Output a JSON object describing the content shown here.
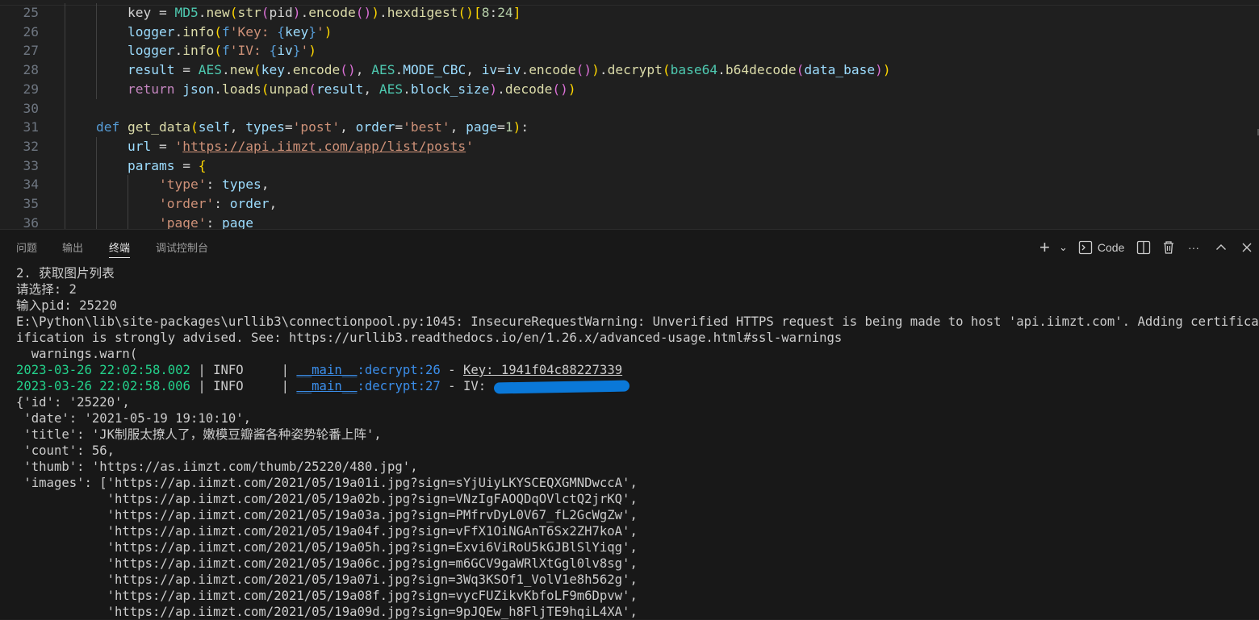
{
  "editor": {
    "lines": [
      {
        "num": "25",
        "tokens": [
          [
            "pl",
            "key = "
          ],
          [
            "cls",
            "MD5"
          ],
          [
            "pl",
            "."
          ],
          [
            "fn",
            "new"
          ],
          [
            "p1",
            "("
          ],
          [
            "fn",
            "str"
          ],
          [
            "p2",
            "("
          ],
          [
            "pl",
            "pid"
          ],
          [
            "p2",
            ")"
          ],
          [
            "pl",
            "."
          ],
          [
            "fn",
            "encode"
          ],
          [
            "p2",
            "()"
          ],
          [
            "p1",
            ")"
          ],
          [
            "pl",
            "."
          ],
          [
            "fn",
            "hexdigest"
          ],
          [
            "p1",
            "()"
          ],
          [
            "p1",
            "["
          ],
          [
            "num",
            "8"
          ],
          [
            "pl",
            ":"
          ],
          [
            "num",
            "24"
          ],
          [
            "p1",
            "]"
          ]
        ],
        "indent": 2
      },
      {
        "num": "26",
        "tokens": [
          [
            "var",
            "logger"
          ],
          [
            "pl",
            "."
          ],
          [
            "fn",
            "info"
          ],
          [
            "p1",
            "("
          ],
          [
            "kw",
            "f"
          ],
          [
            "str",
            "'Key: "
          ],
          [
            "kw",
            "{"
          ],
          [
            "var",
            "key"
          ],
          [
            "kw",
            "}"
          ],
          [
            "str",
            "'"
          ],
          [
            "p1",
            ")"
          ]
        ],
        "indent": 2
      },
      {
        "num": "27",
        "tokens": [
          [
            "var",
            "logger"
          ],
          [
            "pl",
            "."
          ],
          [
            "fn",
            "info"
          ],
          [
            "p1",
            "("
          ],
          [
            "kw",
            "f"
          ],
          [
            "str",
            "'IV: "
          ],
          [
            "kw",
            "{"
          ],
          [
            "var",
            "iv"
          ],
          [
            "kw",
            "}"
          ],
          [
            "str",
            "'"
          ],
          [
            "p1",
            ")"
          ]
        ],
        "indent": 2
      },
      {
        "num": "28",
        "tokens": [
          [
            "var",
            "result"
          ],
          [
            "pl",
            " = "
          ],
          [
            "cls",
            "AES"
          ],
          [
            "pl",
            "."
          ],
          [
            "fn",
            "new"
          ],
          [
            "p1",
            "("
          ],
          [
            "var",
            "key"
          ],
          [
            "pl",
            "."
          ],
          [
            "fn",
            "encode"
          ],
          [
            "p2",
            "()"
          ],
          [
            "pl",
            ", "
          ],
          [
            "cls",
            "AES"
          ],
          [
            "pl",
            "."
          ],
          [
            "var",
            "MODE_CBC"
          ],
          [
            "pl",
            ", "
          ],
          [
            "var",
            "iv"
          ],
          [
            "pl",
            "="
          ],
          [
            "var",
            "iv"
          ],
          [
            "pl",
            "."
          ],
          [
            "fn",
            "encode"
          ],
          [
            "p2",
            "()"
          ],
          [
            "p1",
            ")"
          ],
          [
            "pl",
            "."
          ],
          [
            "fn",
            "decrypt"
          ],
          [
            "p1",
            "("
          ],
          [
            "cls",
            "base64"
          ],
          [
            "pl",
            "."
          ],
          [
            "fn",
            "b64decode"
          ],
          [
            "p2",
            "("
          ],
          [
            "var",
            "data_base"
          ],
          [
            "p2",
            ")"
          ],
          [
            "p1",
            ")"
          ]
        ],
        "indent": 2
      },
      {
        "num": "29",
        "tokens": [
          [
            "ctrl",
            "return "
          ],
          [
            "var",
            "json"
          ],
          [
            "pl",
            "."
          ],
          [
            "fn",
            "loads"
          ],
          [
            "p1",
            "("
          ],
          [
            "fn",
            "unpad"
          ],
          [
            "p2",
            "("
          ],
          [
            "var",
            "result"
          ],
          [
            "pl",
            ", "
          ],
          [
            "cls",
            "AES"
          ],
          [
            "pl",
            "."
          ],
          [
            "var",
            "block_size"
          ],
          [
            "p2",
            ")"
          ],
          [
            "pl",
            "."
          ],
          [
            "fn",
            "decode"
          ],
          [
            "p2",
            "()"
          ],
          [
            "p1",
            ")"
          ]
        ],
        "indent": 2
      },
      {
        "num": "30",
        "tokens": [],
        "indent": 1
      },
      {
        "num": "31",
        "tokens": [
          [
            "kw",
            "def "
          ],
          [
            "fn",
            "get_data"
          ],
          [
            "p1",
            "("
          ],
          [
            "var",
            "self"
          ],
          [
            "pl",
            ", "
          ],
          [
            "var",
            "types"
          ],
          [
            "pl",
            "="
          ],
          [
            "str",
            "'post'"
          ],
          [
            "pl",
            ", "
          ],
          [
            "var",
            "order"
          ],
          [
            "pl",
            "="
          ],
          [
            "str",
            "'best'"
          ],
          [
            "pl",
            ", "
          ],
          [
            "var",
            "page"
          ],
          [
            "pl",
            "="
          ],
          [
            "num",
            "1"
          ],
          [
            "p1",
            ")"
          ],
          [
            "pl",
            ":"
          ]
        ],
        "indent": 1
      },
      {
        "num": "32",
        "tokens": [
          [
            "var",
            "url"
          ],
          [
            "pl",
            " = "
          ],
          [
            "str",
            "'"
          ],
          [
            "url",
            "https://api.iimzt.com/app/list/posts"
          ],
          [
            "str",
            "'"
          ]
        ],
        "indent": 2
      },
      {
        "num": "33",
        "tokens": [
          [
            "var",
            "params"
          ],
          [
            "pl",
            " = "
          ],
          [
            "p1",
            "{"
          ]
        ],
        "indent": 2
      },
      {
        "num": "34",
        "tokens": [
          [
            "str",
            "'type'"
          ],
          [
            "pl",
            ": "
          ],
          [
            "var",
            "types"
          ],
          [
            "pl",
            ","
          ]
        ],
        "indent": 3
      },
      {
        "num": "35",
        "tokens": [
          [
            "str",
            "'order'"
          ],
          [
            "pl",
            ": "
          ],
          [
            "var",
            "order"
          ],
          [
            "pl",
            ","
          ]
        ],
        "indent": 3
      },
      {
        "num": "36",
        "tokens": [
          [
            "str",
            "'page'"
          ],
          [
            "pl",
            ": "
          ],
          [
            "var",
            "page"
          ]
        ],
        "indent": 3
      }
    ]
  },
  "panel": {
    "tabs": [
      "问题",
      "输出",
      "终端",
      "调试控制台"
    ],
    "active_tab": 2,
    "actions": {
      "add": "+",
      "dropdown": "⌄",
      "shell_label": "Code",
      "split": "split",
      "trash": "trash",
      "more": "···",
      "maximize": "^",
      "close": "✕"
    }
  },
  "terminal": {
    "lines": [
      "2. 获取图片列表",
      "请选择: 2",
      "输入pid: 25220",
      "E:\\Python\\lib\\site-packages\\urllib3\\connectionpool.py:1045: InsecureRequestWarning: Unverified HTTPS request is being made to host 'api.iimzt.com'. Adding certificate ver",
      "ification is strongly advised. See: https://urllib3.readthedocs.io/en/1.26.x/advanced-usage.html#ssl-warnings",
      "  warnings.warn("
    ],
    "logs": [
      {
        "time": "2023-03-26 22:02:58.002",
        "level": "INFO",
        "module": "__main__",
        "func": "decrypt",
        "line": "26",
        "msg": "Key: 1941f04c88227339",
        "redacted": false
      },
      {
        "time": "2023-03-26 22:02:58.006",
        "level": "INFO",
        "module": "__main__",
        "func": "decrypt",
        "line": "27",
        "msg": "IV:",
        "redacted": true
      }
    ],
    "dict_lines": [
      "{'id': '25220',",
      " 'date': '2021-05-19 19:10:10',",
      " 'title': 'JK制服太撩人了，嫩模豆瓣酱各种姿势轮番上阵',",
      " 'count': 56,",
      " 'thumb': 'https://as.iimzt.com/thumb/25220/480.jpg',",
      " 'images': ['https://ap.iimzt.com/2021/05/19a01i.jpg?sign=sYjUiyLKYSCEQXGMNDwccA',",
      "            'https://ap.iimzt.com/2021/05/19a02b.jpg?sign=VNzIgFAOQDqOVlctQ2jrKQ',",
      "            'https://ap.iimzt.com/2021/05/19a03a.jpg?sign=PMfrvDyL0V67_fL2GcWgZw',",
      "            'https://ap.iimzt.com/2021/05/19a04f.jpg?sign=vFfX1OiNGAnT6Sx2ZH7koA',",
      "            'https://ap.iimzt.com/2021/05/19a05h.jpg?sign=Exvi6ViRoU5kGJBlSlYiqg',",
      "            'https://ap.iimzt.com/2021/05/19a06c.jpg?sign=m6GCV9gaWRlXtGgl0lv8sg',",
      "            'https://ap.iimzt.com/2021/05/19a07i.jpg?sign=3Wq3KSOf1_VolV1e8h562g',",
      "            'https://ap.iimzt.com/2021/05/19a08f.jpg?sign=vycFUZikvKbfoLF9m6Dpvw',",
      "            'https://ap.iimzt.com/2021/05/19a09d.jpg?sign=9pJQEw_h8FljTE9hqiL4XA',"
    ]
  }
}
